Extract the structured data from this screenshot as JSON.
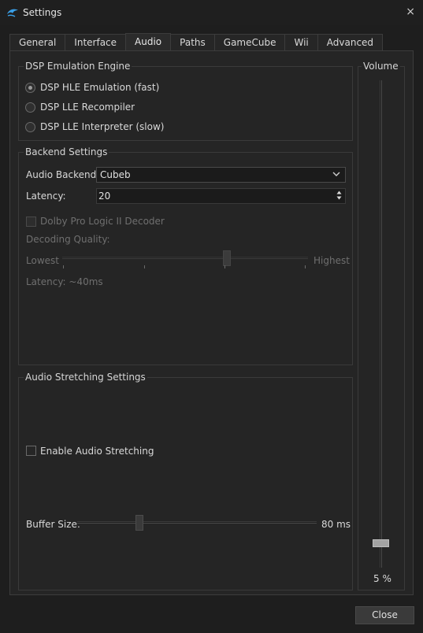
{
  "window": {
    "title": "Settings",
    "close_glyph": "×",
    "icon": "dolphin-icon"
  },
  "tabs": [
    {
      "label": "General"
    },
    {
      "label": "Interface"
    },
    {
      "label": "Audio",
      "active": true
    },
    {
      "label": "Paths"
    },
    {
      "label": "GameCube"
    },
    {
      "label": "Wii"
    },
    {
      "label": "Advanced"
    }
  ],
  "dsp": {
    "title": "DSP Emulation Engine",
    "options": [
      {
        "label": "DSP HLE Emulation (fast)",
        "selected": true
      },
      {
        "label": "DSP LLE Recompiler",
        "selected": false
      },
      {
        "label": "DSP LLE Interpreter (slow)",
        "selected": false
      }
    ]
  },
  "backend": {
    "title": "Backend Settings",
    "audio_backend_label": "Audio Backend:",
    "audio_backend_value": "Cubeb",
    "latency_label": "Latency:",
    "latency_value": "20",
    "dolby_label": "Dolby Pro Logic II Decoder",
    "dolby_checked": false,
    "decoding_quality_label": "Decoding Quality:",
    "quality_min_label": "Lowest",
    "quality_max_label": "Highest",
    "quality_level": 0.67,
    "latency_readout": "Latency: ~40ms"
  },
  "stretching": {
    "title": "Audio Stretching Settings",
    "enable_label": "Enable Audio Stretching",
    "enable_checked": false,
    "buffer_label": "Buffer Size:",
    "buffer_value_text": "80 ms",
    "buffer_level": 0.26
  },
  "volume": {
    "title": "Volume",
    "value_text": "5 %",
    "level": 0.05
  },
  "footer": {
    "close_label": "Close"
  },
  "colors": {
    "background": "#1e1e1e",
    "panel": "#252525",
    "border": "#3c3c3c",
    "text": "#d6d6d6",
    "disabled_text": "#6f6f6f"
  }
}
